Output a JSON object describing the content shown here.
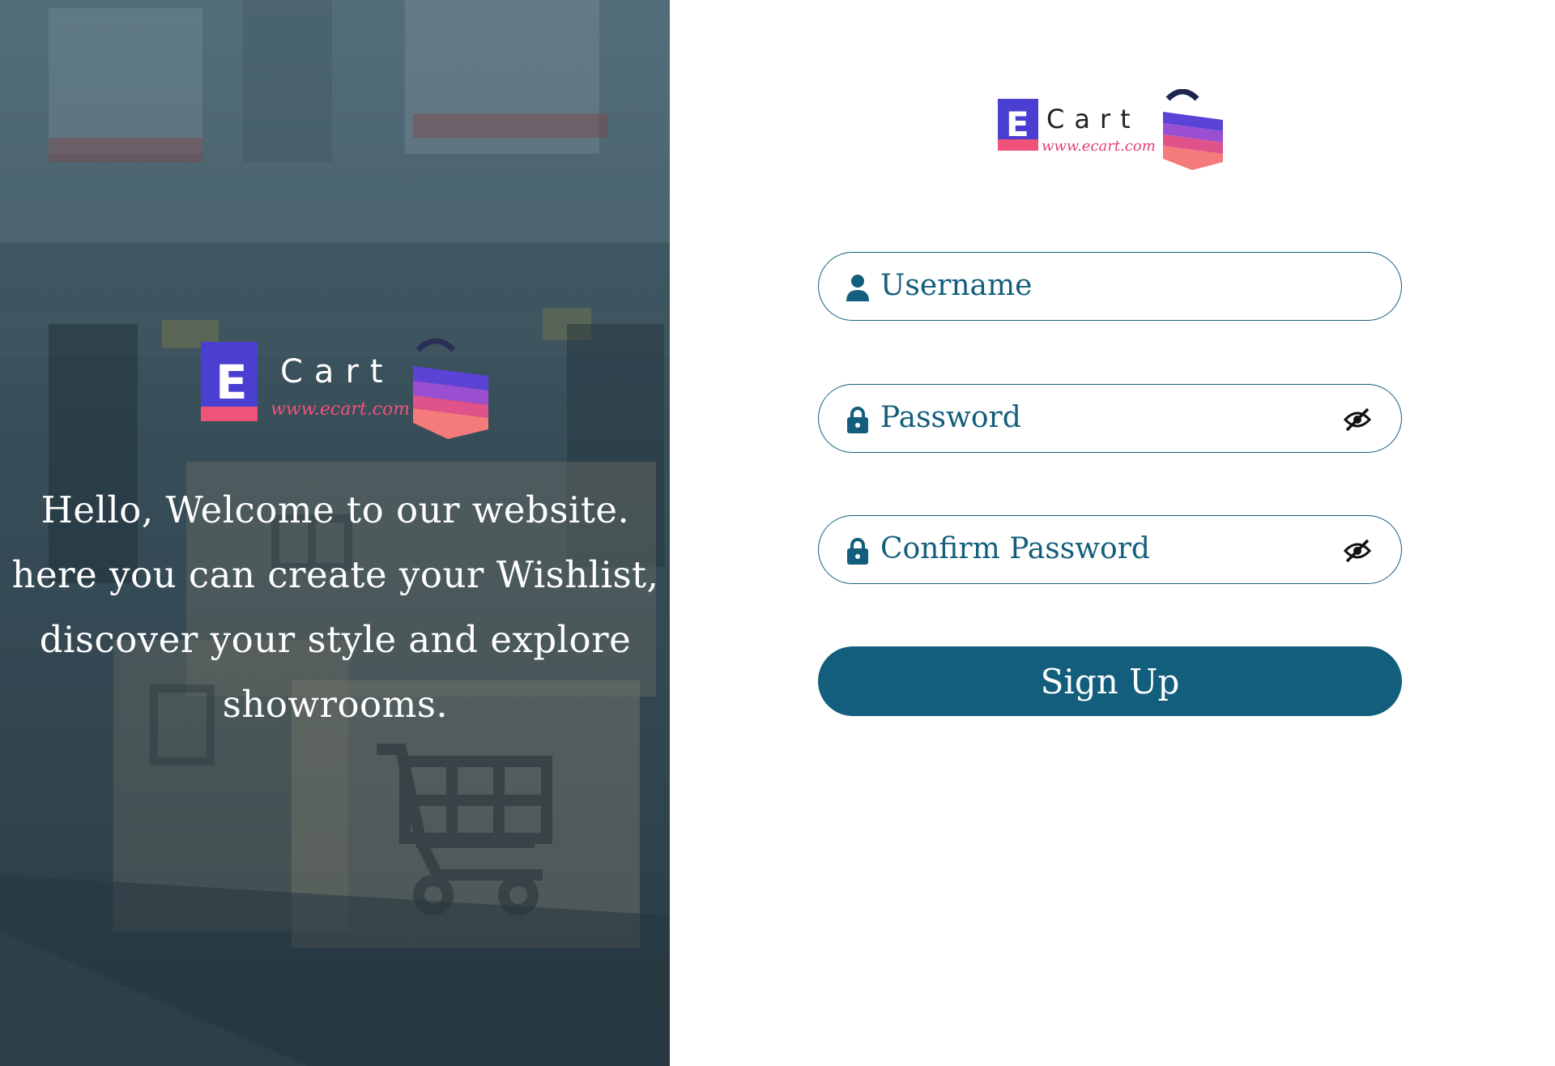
{
  "colors": {
    "primary": "#135e7c",
    "brand_blue": "#4a3fd0",
    "brand_pink": "#f0527a",
    "hero_overlay": "#3a4f58"
  },
  "hero": {
    "logo": {
      "brand": "Cart",
      "letter": "E",
      "url": "www.ecart.com"
    },
    "welcome_text": "Hello, Welcome to our website. here you can create your Wishlist, discover your style and explore showrooms."
  },
  "form": {
    "logo": {
      "brand": "Cart",
      "letter": "E",
      "url": "www.ecart.com"
    },
    "username": {
      "placeholder": "Username",
      "icon": "user-icon"
    },
    "password": {
      "placeholder": "Password",
      "icon": "lock-icon",
      "toggle_icon": "eye-slash-icon"
    },
    "confirm_password": {
      "placeholder": "Confirm Password",
      "icon": "lock-icon",
      "toggle_icon": "eye-slash-icon"
    },
    "submit_label": "Sign Up"
  }
}
